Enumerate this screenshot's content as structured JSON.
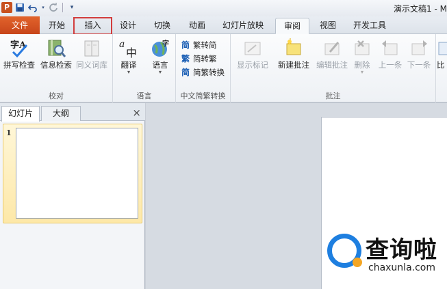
{
  "titlebar": {
    "app_icon": "P",
    "title": "演示文稿1 - M",
    "quick_access": [
      "save-icon",
      "undo-icon",
      "redo-icon",
      "customize-icon"
    ]
  },
  "tabs": [
    {
      "label": "文件",
      "state": "file"
    },
    {
      "label": "开始",
      "state": "normal"
    },
    {
      "label": "插入",
      "state": "highlighted"
    },
    {
      "label": "设计",
      "state": "normal"
    },
    {
      "label": "切换",
      "state": "normal"
    },
    {
      "label": "动画",
      "state": "normal"
    },
    {
      "label": "幻灯片放映",
      "state": "normal"
    },
    {
      "label": "审阅",
      "state": "active"
    },
    {
      "label": "视图",
      "state": "normal"
    },
    {
      "label": "开发工具",
      "state": "normal"
    }
  ],
  "ribbon": {
    "proofing": {
      "label": "校对",
      "spell_check": "拼写检查",
      "research": "信息检索",
      "thesaurus": "同义词库"
    },
    "language": {
      "label": "语言",
      "translate": "翻译",
      "language": "语言"
    },
    "chinese_conversion": {
      "label": "中文简繁转换",
      "to_simplified": "繁转简",
      "to_traditional": "简转繁",
      "convert": "简繁转换",
      "to_simplified_icon": "简",
      "to_traditional_icon": "繁",
      "convert_icon": "简"
    },
    "comments": {
      "label": "批注",
      "show_markup": "显示标记",
      "new_comment": "新建批注",
      "edit_comment": "编辑批注",
      "delete": "删除",
      "previous": "上一条",
      "next": "下一条"
    },
    "compare_partial": "比"
  },
  "panel": {
    "tab_slides": "幻灯片",
    "tab_outline": "大纲",
    "close": "×",
    "slide_number": "1"
  },
  "watermark": {
    "brand": "查询啦",
    "url": "chaxunla.com"
  },
  "colors": {
    "file_tab": "#d2521f",
    "highlight_box": "#d23c3c",
    "brand_blue": "#1e7fe0",
    "brand_orange": "#f5a623"
  }
}
